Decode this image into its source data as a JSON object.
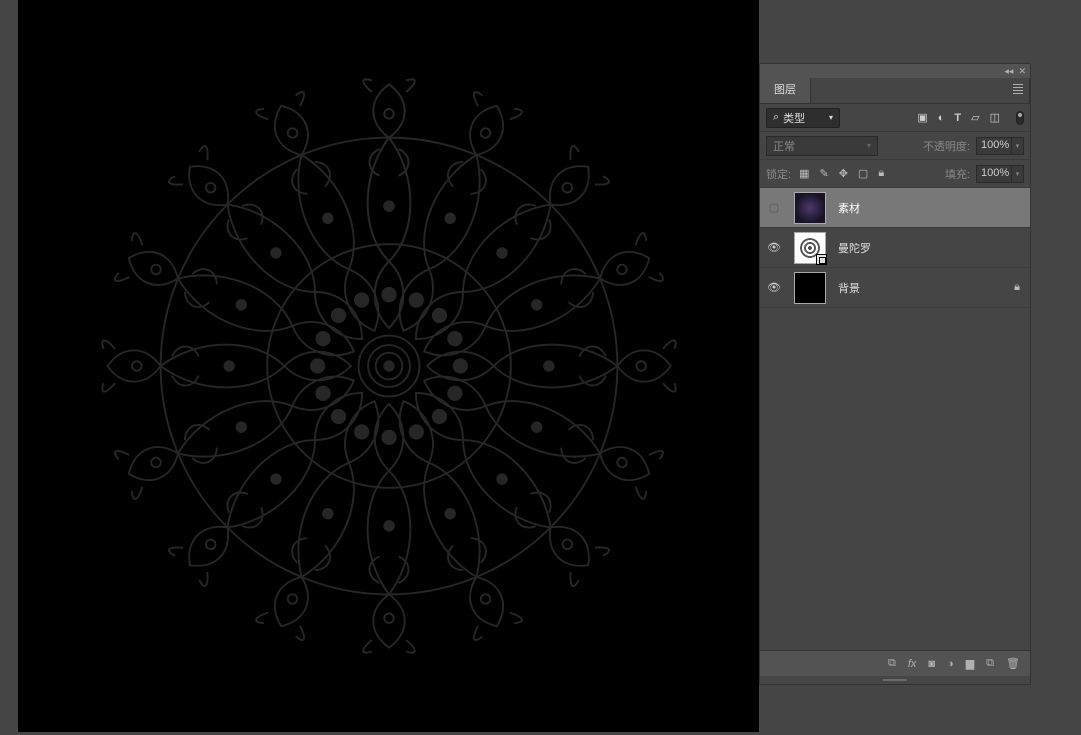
{
  "panel": {
    "tab_layers": "图层",
    "kind_filter": "类型",
    "blend_mode": "正常",
    "opacity_label": "不透明度:",
    "opacity_value": "100%",
    "lock_label": "锁定:",
    "fill_label": "填充:",
    "fill_value": "100%",
    "layers": [
      {
        "name": "素材",
        "visible": false,
        "selected": true,
        "thumb": "purple",
        "smart": false,
        "locked": false
      },
      {
        "name": "曼陀罗",
        "visible": true,
        "selected": false,
        "thumb": "mandala",
        "smart": true,
        "locked": false
      },
      {
        "name": "背景",
        "visible": true,
        "selected": false,
        "thumb": "black",
        "smart": false,
        "locked": true
      }
    ]
  }
}
